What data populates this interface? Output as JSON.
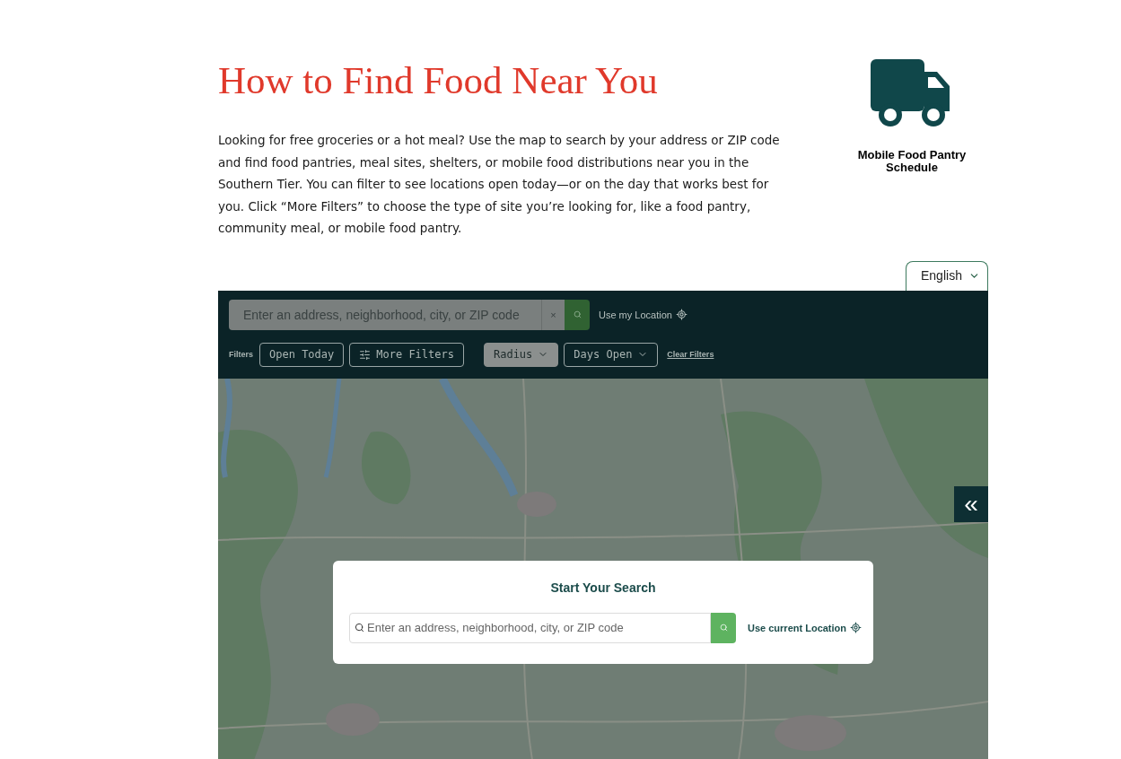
{
  "heading": "How to Find Food Near You",
  "intro": "Looking for free groceries or a hot meal? Use the map to search by your address or ZIP code and find food pantries, meal sites, shelters, or mobile food distributions near you in the Southern Tier. You can filter to see locations open today—or on the day that works best for you. Click “More Filters” to choose the type of site you’re looking for, like a food pantry, community meal, or mobile food pantry.",
  "schedule_link": {
    "label": "Mobile Food Pantry Schedule"
  },
  "language": {
    "value": "English"
  },
  "toolbar": {
    "search": {
      "placeholder": "Enter an address, neighborhood, city, or ZIP code"
    },
    "clear": "×",
    "location": "Use my Location",
    "filters_label": "Filters",
    "filters": [
      {
        "label": "Open Today",
        "kind": "toggle",
        "selected": false
      },
      {
        "label": "More Filters",
        "kind": "panel",
        "selected": false
      },
      {
        "label": "Radius",
        "kind": "dropdown",
        "selected": true
      },
      {
        "label": "Days Open",
        "kind": "dropdown",
        "selected": false
      }
    ],
    "clear_filters": "Clear Filters"
  },
  "map": {
    "kind": "picture",
    "collapse": "«"
  },
  "modal": {
    "title": "Start Your Search",
    "search": {
      "placeholder": "Enter an address, neighborhood, city, or ZIP code"
    },
    "location": "Use current Location"
  }
}
